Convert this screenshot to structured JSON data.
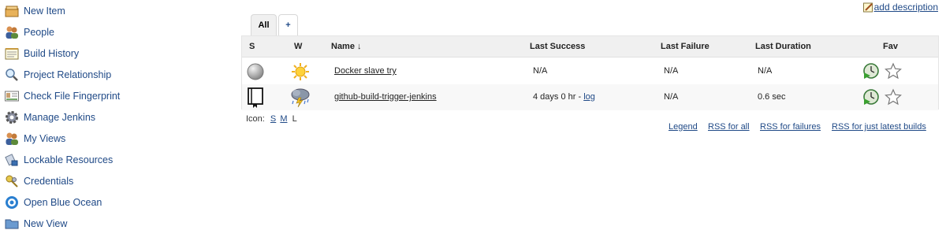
{
  "sidebar": {
    "items": [
      {
        "label": "New Item",
        "icon": "new-item-icon"
      },
      {
        "label": "People",
        "icon": "people-icon"
      },
      {
        "label": "Build History",
        "icon": "notepad-icon"
      },
      {
        "label": "Project Relationship",
        "icon": "magnifier-icon"
      },
      {
        "label": "Check File Fingerprint",
        "icon": "fingerprint-card-icon"
      },
      {
        "label": "Manage Jenkins",
        "icon": "gear-icon"
      },
      {
        "label": "My Views",
        "icon": "people-icon"
      },
      {
        "label": "Lockable Resources",
        "icon": "lock-icon"
      },
      {
        "label": "Credentials",
        "icon": "key-icon"
      },
      {
        "label": "Open Blue Ocean",
        "icon": "blue-ocean-icon"
      },
      {
        "label": "New View",
        "icon": "folder-icon"
      }
    ]
  },
  "header": {
    "add_description": "add description"
  },
  "tabs": [
    {
      "label": "All"
    },
    {
      "label": "+"
    }
  ],
  "table": {
    "headers": {
      "s": "S",
      "w": "W",
      "name": "Name ↓",
      "last_success": "Last Success",
      "last_failure": "Last Failure",
      "last_duration": "Last Duration",
      "fav": "Fav"
    },
    "rows": [
      {
        "status": "grey-ball-icon",
        "weather": "sunny-icon",
        "name": "Docker slave try",
        "last_success": "N/A",
        "last_success_link": "",
        "last_failure": "N/A",
        "last_duration": "N/A"
      },
      {
        "status": "pipeline-notebook-icon",
        "weather": "thunderstorm-icon",
        "name": "github-build-trigger-jenkins",
        "last_success": "4 days 0 hr - ",
        "last_success_link": "log",
        "last_failure": "N/A",
        "last_duration": "0.6 sec"
      }
    ]
  },
  "icon_size": {
    "label": "Icon:",
    "s": "S",
    "m": "M",
    "l": "L"
  },
  "footer": {
    "legend": "Legend",
    "rss_all": "RSS for all",
    "rss_failures": "RSS for failures",
    "rss_latest": "RSS for just latest builds"
  },
  "colors": {
    "link": "#204a87",
    "header_bg": "#f0f0f0"
  }
}
